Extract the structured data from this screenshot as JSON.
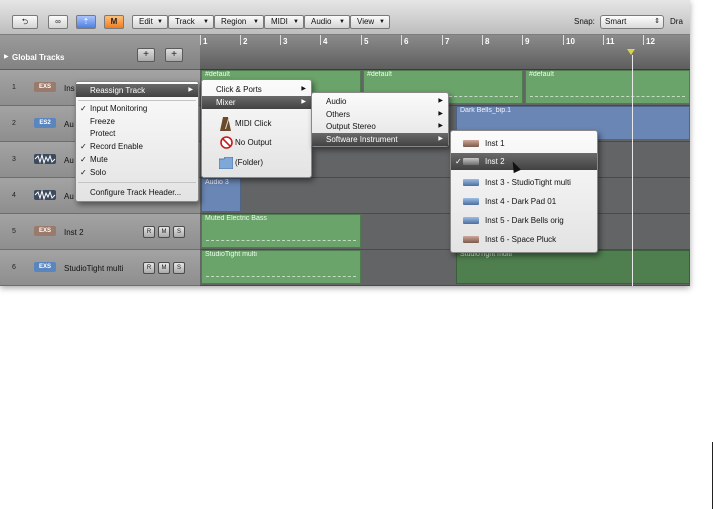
{
  "toolbar": {
    "menus": [
      "Edit",
      "Track",
      "Region",
      "MIDI",
      "Audio",
      "View"
    ],
    "orange_button": "M",
    "snap_label": "Snap:",
    "snap_value": "Smart",
    "drag_label": "Dra"
  },
  "global_tracks": {
    "label": "Global Tracks",
    "add_button": "+",
    "folder_button": "+"
  },
  "ruler": {
    "bars": [
      "1",
      "2",
      "3",
      "4",
      "5",
      "6",
      "7",
      "8",
      "9",
      "10",
      "11",
      "12"
    ]
  },
  "tracks": [
    {
      "number": "1",
      "icon": "EXS",
      "name": "Ins",
      "icon_color": "#9a7a6a",
      "buttons": []
    },
    {
      "number": "2",
      "icon": "ES2",
      "name": "Au",
      "icon_color": "#5a86c0",
      "buttons": []
    },
    {
      "number": "3",
      "icon": "audio",
      "name": "Au",
      "icon_color": "#3c4a5e",
      "buttons": []
    },
    {
      "number": "4",
      "icon": "audio",
      "name": "Au",
      "icon_color": "#3c4a5e",
      "buttons": []
    },
    {
      "number": "5",
      "icon": "EXS",
      "name": "Inst 2",
      "icon_color": "#9a7a6a",
      "buttons": [
        "R",
        "M",
        "S"
      ]
    },
    {
      "number": "6",
      "icon": "EXS",
      "name": "StudioTight multi",
      "icon_color": "#5a86c0",
      "buttons": [
        "R",
        "M",
        "S"
      ]
    }
  ],
  "regions": {
    "r1a": "#default",
    "r1b": "#default",
    "r1c": "#default",
    "r2": "Dark Bells_bip.1",
    "r4": "Audio 3",
    "r5": "Muted Electric Bass",
    "r6a": "StudioTight multi",
    "r6b": "StudioTight multi"
  },
  "context_menu": {
    "reassign": "Reassign Track",
    "input_monitoring": "Input Monitoring",
    "freeze": "Freeze",
    "protect": "Protect",
    "record_enable": "Record Enable",
    "mute": "Mute",
    "solo": "Solo",
    "configure": "Configure Track Header..."
  },
  "submenu1": {
    "click_ports": "Click & Ports",
    "mixer": "Mixer",
    "midi_click": "MIDI Click",
    "no_output": "No Output",
    "folder": "(Folder)"
  },
  "submenu2": {
    "audio": "Audio",
    "others": "Others",
    "output_stereo": "Output Stereo",
    "software_instrument": "Software Instrument"
  },
  "submenu3": {
    "items": [
      "Inst 1",
      "Inst 2",
      "Inst 3 - StudioTight multi",
      "Inst 4 - Dark Pad 01",
      "Inst 5 - Dark Bells orig",
      "Inst 6 - Space Pluck"
    ],
    "checked": "Inst 2"
  },
  "check_mark": "✓",
  "submenu_arrow": "▶",
  "colors": {
    "region_green": "#6aa46a",
    "region_blue": "#6a86b4",
    "menu_highlight": "#4a4a4a",
    "orange_button": "#ee7d1f",
    "blue_button": "#4f7de0"
  }
}
